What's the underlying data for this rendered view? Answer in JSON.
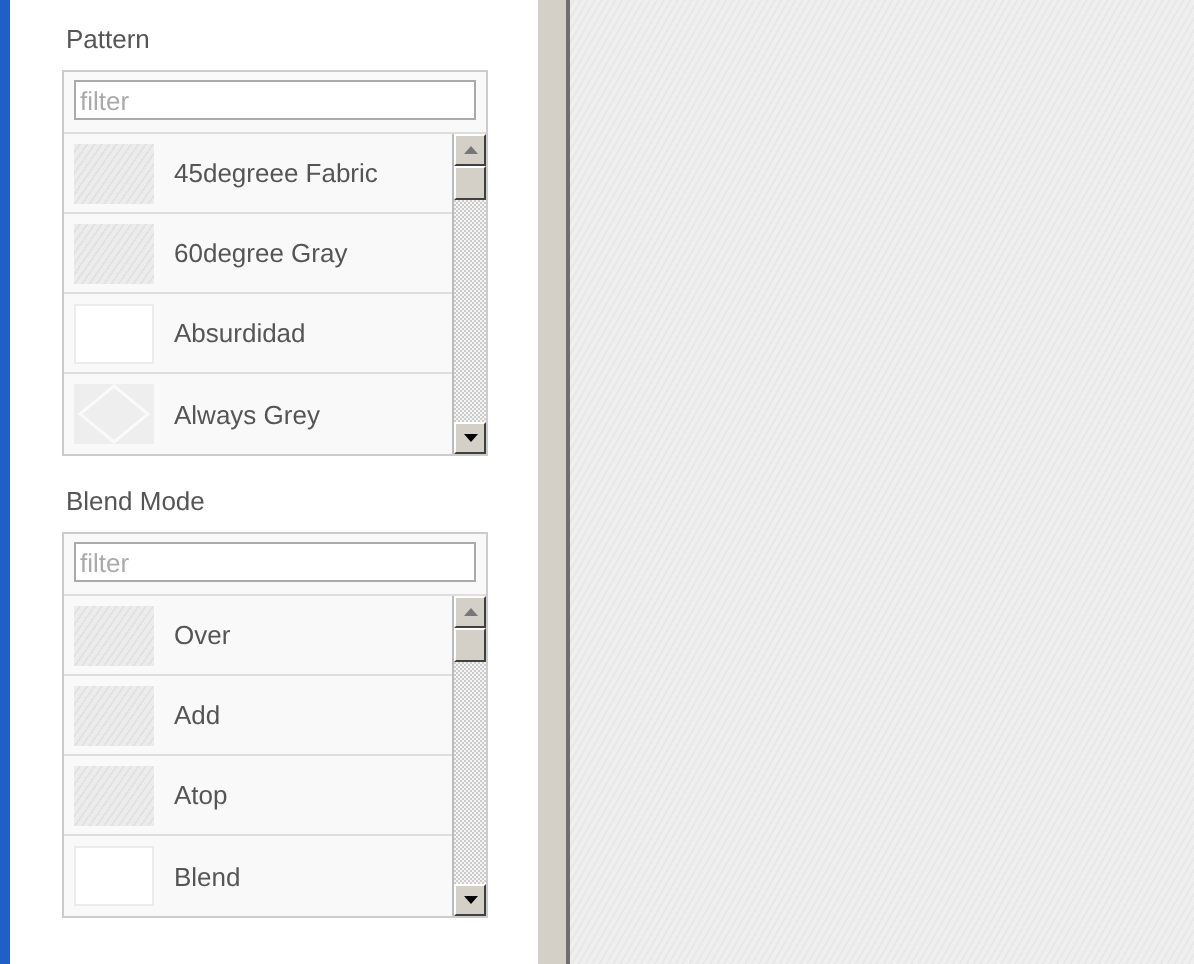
{
  "sections": [
    {
      "label": "Pattern",
      "filter": {
        "placeholder": "filter"
      },
      "items": [
        {
          "name": "45degreee Fabric",
          "kind": "textured"
        },
        {
          "name": "60degree Gray",
          "kind": "textured"
        },
        {
          "name": "Absurdidad",
          "kind": "plain"
        },
        {
          "name": "Always Grey",
          "kind": "diamond"
        }
      ]
    },
    {
      "label": "Blend Mode",
      "filter": {
        "placeholder": "filter"
      },
      "items": [
        {
          "name": "Over",
          "kind": "textured"
        },
        {
          "name": "Add",
          "kind": "textured"
        },
        {
          "name": "Atop",
          "kind": "textured"
        },
        {
          "name": "Blend",
          "kind": "plain"
        }
      ]
    }
  ]
}
